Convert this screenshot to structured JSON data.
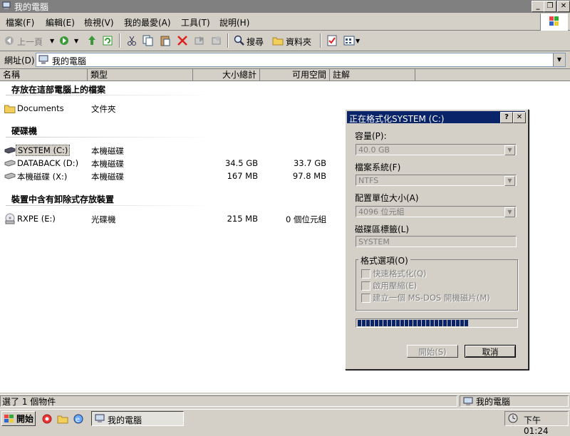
{
  "window": {
    "title": "我的電腦",
    "min_glyph": "_",
    "max_glyph": "❐",
    "close_glyph": "✕"
  },
  "menu": [
    "檔案(F)",
    "編輯(E)",
    "檢視(V)",
    "我的最愛(A)",
    "工具(T)",
    "說明(H)"
  ],
  "toolbar": {
    "back_label": "上一頁",
    "search_label": "搜尋",
    "folders_label": "資料夾"
  },
  "address": {
    "label": "網址(D)",
    "value": "我的電腦"
  },
  "columns": [
    "名稱",
    "類型",
    "大小總計",
    "可用空間",
    "註解"
  ],
  "groups": {
    "files": "存放在這部電腦上的檔案",
    "hdd": "硬碟機",
    "removable": "裝置中含有卸除式存放裝置"
  },
  "items": {
    "documents": {
      "name": "Documents",
      "type": "文件夾",
      "size": "",
      "free": ""
    },
    "system": {
      "name": "SYSTEM (C:)",
      "type": "本機磁碟",
      "size": "",
      "free": ""
    },
    "databack": {
      "name": "DATABACK (D:)",
      "type": "本機磁碟",
      "size": "34.5 GB",
      "free": "33.7 GB"
    },
    "localx": {
      "name": "本機磁碟 (X:)",
      "type": "本機磁碟",
      "size": "167 MB",
      "free": "97.8 MB"
    },
    "rxpe": {
      "name": "RXPE (E:)",
      "type": "光碟機",
      "size": "215 MB",
      "free": "0 個位元組"
    }
  },
  "dialog": {
    "title": "正在格式化SYSTEM (C:)",
    "help_glyph": "?",
    "close_glyph": "✕",
    "capacity_label": "容量(P):",
    "capacity_value": "40.0 GB",
    "fs_label": "檔案系統(F)",
    "fs_value": "NTFS",
    "alloc_label": "配置單位大小(A)",
    "alloc_value": "4096 位元組",
    "volume_label": "磁碟區標籤(L)",
    "volume_value": "SYSTEM",
    "options_label": "格式選項(O)",
    "opt_quick": "快速格式化(Q)",
    "opt_compress": "啟用壓縮(E)",
    "opt_msdos": "建立一個 MS-DOS 開機磁片(M)",
    "progress": 0.7,
    "start_label": "開始(S)",
    "cancel_label": "取消"
  },
  "status": {
    "left": "選了 1 個物件",
    "right": "我的電腦"
  },
  "taskbar": {
    "start_label": "開始",
    "task_label": "我的電腦",
    "clock": "下午 01:24"
  },
  "colors": {
    "title_inactive": "#808080",
    "dialog_title": "#0a246a",
    "progress": "#0a246a",
    "face": "#d4d0c8"
  }
}
